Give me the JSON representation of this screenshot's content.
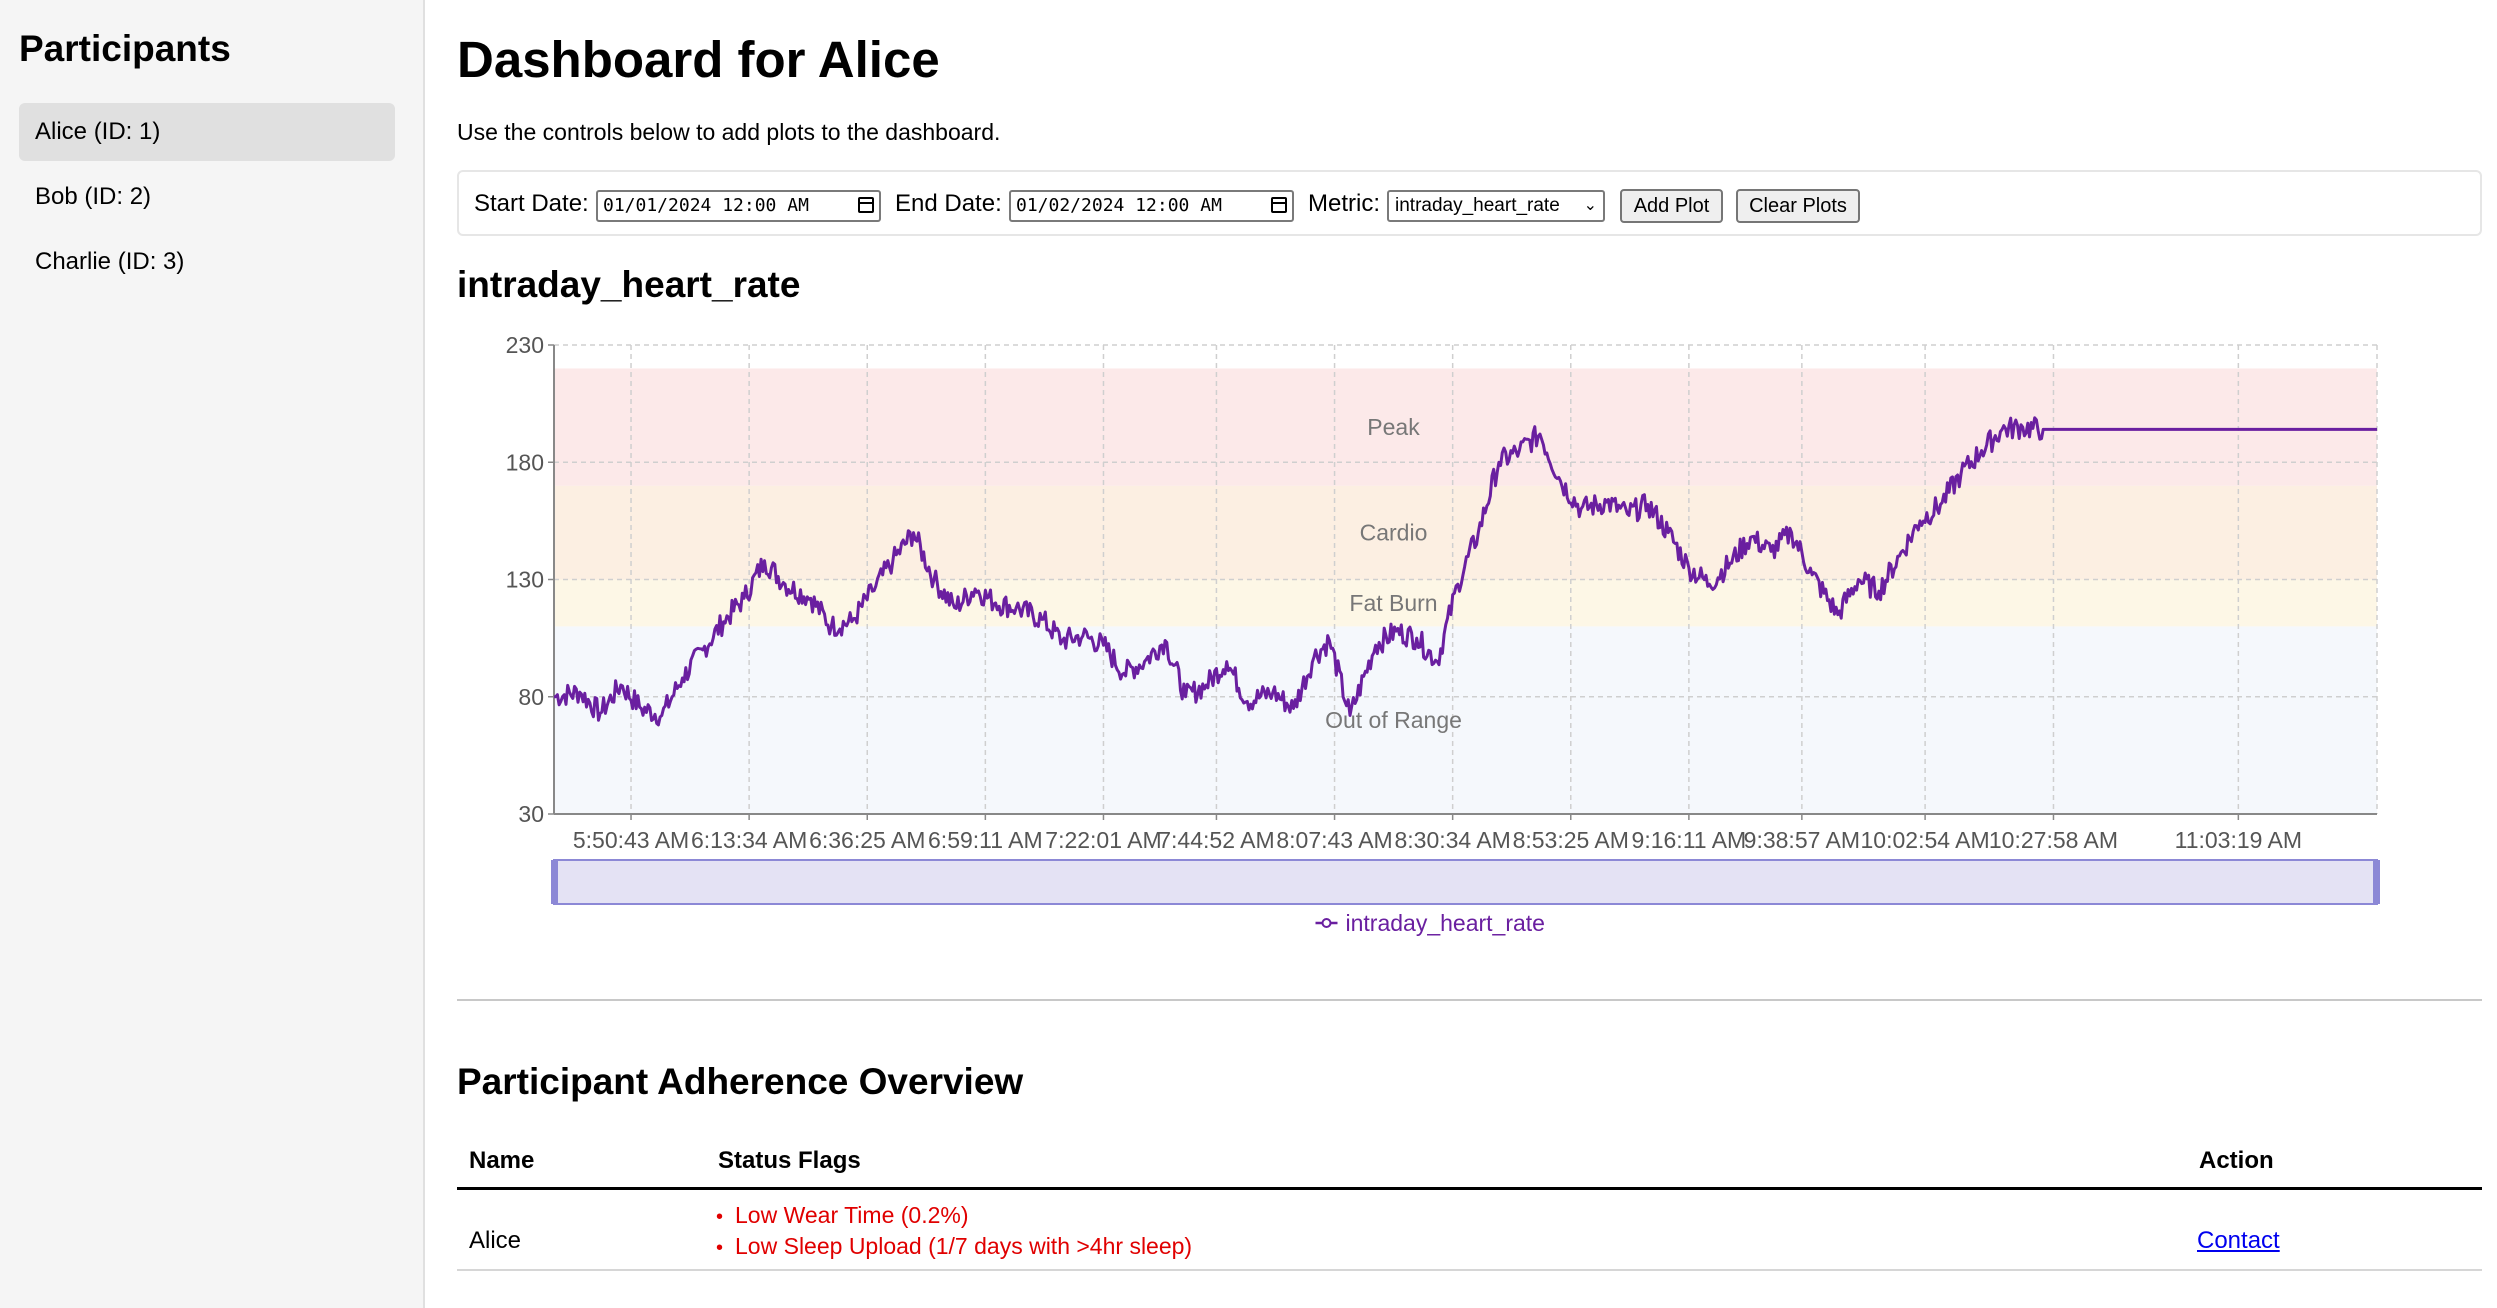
{
  "sidebar": {
    "title": "Participants",
    "items": [
      {
        "label": "Alice (ID: 1)",
        "active": true
      },
      {
        "label": "Bob (ID: 2)",
        "active": false
      },
      {
        "label": "Charlie (ID: 3)",
        "active": false
      }
    ]
  },
  "main": {
    "title": "Dashboard for Alice",
    "intro": "Use the controls below to add plots to the dashboard."
  },
  "controls": {
    "start_label": "Start Date:",
    "start_value": "01/01/2024 12:00 AM",
    "end_label": "End Date:",
    "end_value": "01/02/2024 12:00 AM",
    "metric_label": "Metric:",
    "metric_value": "intraday_heart_rate",
    "add_plot": "Add Plot",
    "clear_plots": "Clear Plots"
  },
  "plot": {
    "title": "intraday_heart_rate"
  },
  "chart_data": {
    "type": "line",
    "ylim": [
      30,
      230
    ],
    "yticks": [
      30,
      80,
      130,
      180,
      230
    ],
    "xtick_labels": [
      "5:50:43 AM",
      "6:13:34 AM",
      "6:36:25 AM",
      "6:59:11 AM",
      "7:22:01 AM",
      "7:44:52 AM",
      "8:07:43 AM",
      "8:30:34 AM",
      "8:53:25 AM",
      "9:16:11 AM",
      "9:38:57 AM",
      "10:02:54 AM",
      "10:27:58 AM",
      "11:03:19 AM"
    ],
    "grid": true,
    "zones": [
      {
        "name": "Out of Range",
        "from": 30,
        "to": 110,
        "color": "#f5f8fc"
      },
      {
        "name": "Fat Burn",
        "from": 110,
        "to": 130,
        "color": "#fdf7e6"
      },
      {
        "name": "Cardio",
        "from": 130,
        "to": 170,
        "color": "#fcefe2"
      },
      {
        "name": "Peak",
        "from": 170,
        "to": 220,
        "color": "#fce9e9"
      }
    ],
    "series": [
      {
        "name": "intraday_heart_rate",
        "color": "#6a1fa0",
        "x": [
          "5:35 AM",
          "5:40 AM",
          "5:44 AM",
          "5:48 AM",
          "5:52 AM",
          "5:56 AM",
          "6:00 AM",
          "6:04 AM",
          "6:08 AM",
          "6:12 AM",
          "6:16 AM",
          "6:20 AM",
          "6:25 AM",
          "6:29 AM",
          "6:33 AM",
          "6:37 AM",
          "6:41 AM",
          "6:45 AM",
          "6:49 AM",
          "6:53 AM",
          "6:57 AM",
          "7:01 AM",
          "7:05 AM",
          "7:10 AM",
          "7:14 AM",
          "7:18 AM",
          "7:22 AM",
          "7:26 AM",
          "7:30 AM",
          "7:34 AM",
          "7:38 AM",
          "7:42 AM",
          "7:46 AM",
          "7:50 AM",
          "7:55 AM",
          "7:59 AM",
          "8:03 AM",
          "8:06 AM",
          "8:10 AM",
          "8:15 AM",
          "8:19 AM",
          "8:23 AM",
          "8:27 AM",
          "8:31 AM",
          "8:35 AM",
          "8:39 AM",
          "8:43 AM",
          "8:47 AM",
          "8:51 AM",
          "8:55 AM",
          "9:00 AM",
          "9:04 AM",
          "9:08 AM",
          "9:12 AM",
          "9:16 AM",
          "9:20 AM",
          "9:24 AM",
          "9:28 AM",
          "9:32 AM",
          "9:36 AM",
          "9:40 AM",
          "9:45 AM",
          "9:49 AM",
          "9:53 AM",
          "9:57 AM",
          "10:01 AM",
          "10:05 AM",
          "10:09 AM",
          "10:13 AM",
          "10:17 AM",
          "10:21 AM",
          "10:25 AM",
          "10:30 AM",
          "10:40 AM",
          "10:55 AM",
          "11:15 AM",
          "11:30 AM"
        ],
        "values": [
          80,
          82,
          73,
          85,
          75,
          72,
          88,
          100,
          112,
          122,
          138,
          128,
          122,
          110,
          112,
          125,
          138,
          150,
          130,
          118,
          126,
          120,
          118,
          113,
          104,
          106,
          102,
          90,
          95,
          104,
          80,
          85,
          95,
          78,
          82,
          75,
          97,
          104,
          72,
          102,
          108,
          105,
          95,
          128,
          150,
          180,
          185,
          192,
          172,
          160,
          163,
          158,
          162,
          150,
          135,
          128,
          137,
          148,
          142,
          150,
          132,
          115,
          130,
          125,
          140,
          155,
          162,
          175,
          185,
          194,
          195,
          194,
          194,
          194,
          194,
          194,
          194
        ]
      }
    ]
  },
  "adherence": {
    "title": "Participant Adherence Overview",
    "headers": {
      "name": "Name",
      "flags": "Status Flags",
      "action": "Action"
    },
    "rows": [
      {
        "name": "Alice",
        "flags": [
          "Low Wear Time (0.2%)",
          "Low Sleep Upload (1/7 days with >4hr sleep)"
        ],
        "action": "Contact"
      }
    ]
  }
}
